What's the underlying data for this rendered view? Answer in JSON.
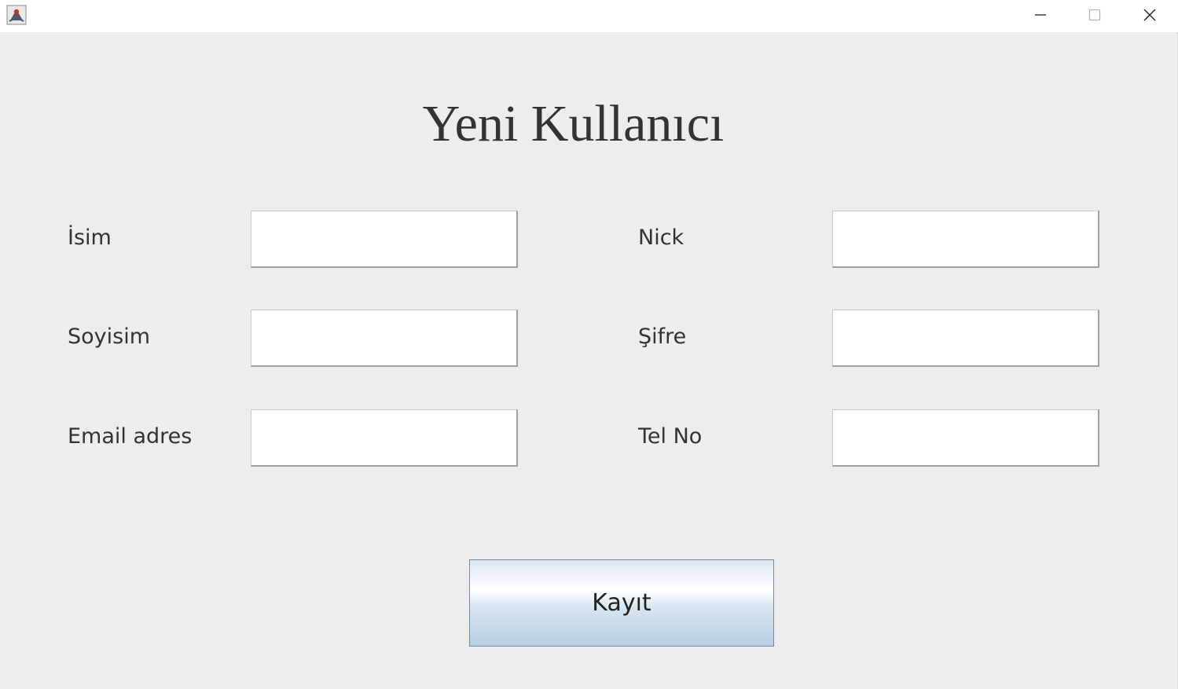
{
  "window": {
    "controls": {
      "minimize_icon": "minimize-icon",
      "maximize_icon": "maximize-icon",
      "close_icon": "close-icon"
    },
    "app_icon": "java-app-icon"
  },
  "form": {
    "title": "Yeni Kullanıcı",
    "left_fields": [
      {
        "label": "İsim",
        "value": ""
      },
      {
        "label": "Soyisim",
        "value": ""
      },
      {
        "label": "Email adres",
        "value": ""
      }
    ],
    "right_fields": [
      {
        "label": "Nick",
        "value": ""
      },
      {
        "label": "Şifre",
        "value": ""
      },
      {
        "label": "Tel No",
        "value": ""
      }
    ],
    "submit_label": "Kayıt"
  },
  "colors": {
    "background": "#ededed",
    "titlebar": "#ffffff",
    "text": "#333333",
    "button_gradient_bottom": "#b9cfe3"
  }
}
